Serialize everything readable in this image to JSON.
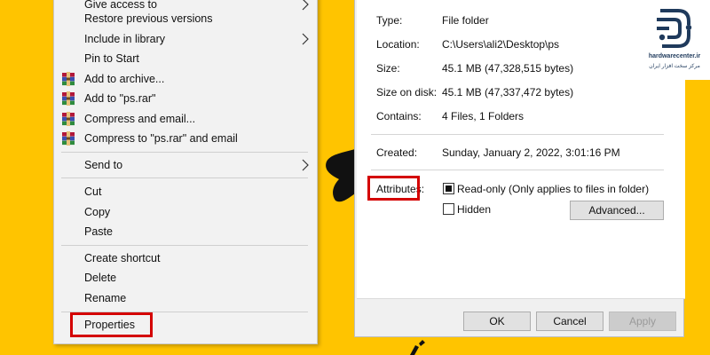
{
  "context_menu": {
    "items": [
      {
        "label": "Give access to",
        "submenu": true
      },
      {
        "label": "Restore previous versions"
      },
      {
        "label": "Include in library",
        "submenu": true
      },
      {
        "label": "Pin to Start"
      },
      {
        "label": "Add to archive...",
        "icon": "winrar-icon"
      },
      {
        "label": "Add to \"ps.rar\"",
        "icon": "winrar-icon"
      },
      {
        "label": "Compress and email...",
        "icon": "winrar-icon"
      },
      {
        "label": "Compress to \"ps.rar\" and email",
        "icon": "winrar-icon"
      },
      {
        "label": "Send to",
        "submenu": true
      },
      {
        "label": "Cut"
      },
      {
        "label": "Copy"
      },
      {
        "label": "Paste"
      },
      {
        "label": "Create shortcut"
      },
      {
        "label": "Delete"
      },
      {
        "label": "Rename"
      },
      {
        "label": "Properties",
        "highlighted": true
      }
    ]
  },
  "properties": {
    "type_label": "Type:",
    "type_value": "File folder",
    "location_label": "Location:",
    "location_value": "C:\\Users\\ali2\\Desktop\\ps",
    "size_label": "Size:",
    "size_value": "45.1 MB (47,328,515 bytes)",
    "size_on_disk_label": "Size on disk:",
    "size_on_disk_value": "45.1 MB (47,337,472 bytes)",
    "contains_label": "Contains:",
    "contains_value": "4 Files, 1 Folders",
    "created_label": "Created:",
    "created_value": "Sunday, January 2, 2022, 3:01:16 PM",
    "attributes_label": "Attributes:",
    "readonly_label": "Read-only (Only applies to files in folder)",
    "readonly_state": "indeterminate",
    "hidden_label": "Hidden",
    "hidden_checked": false,
    "advanced_label": "Advanced...",
    "ok_label": "OK",
    "cancel_label": "Cancel",
    "apply_label": "Apply",
    "apply_disabled": true
  },
  "logo": {
    "name": "hardwarecenter.ir",
    "subtitle": "مرکز سخت افزار ایران"
  },
  "colors": {
    "background": "#FFC400",
    "highlight_box": "#D40000",
    "winrar_red": "#B2183A",
    "logo_navy": "#1F3A5C"
  }
}
